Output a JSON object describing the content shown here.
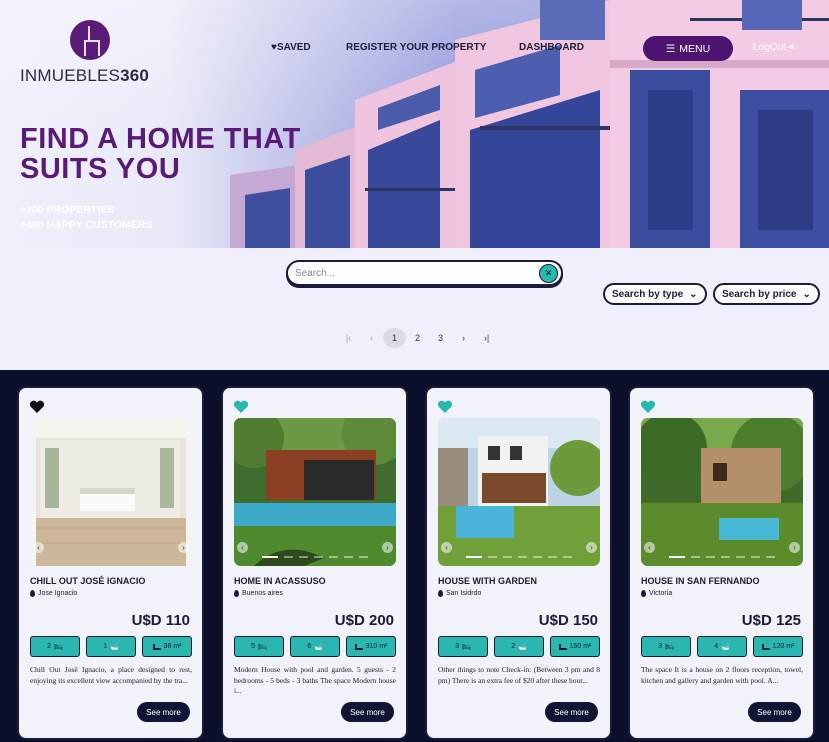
{
  "brand": {
    "name_light": "INMUEBLES",
    "name_bold": "360"
  },
  "nav": {
    "saved": "♥SAVED",
    "register": "REGISTER YOUR PROPERTY",
    "dashboard": "DASHBOARD",
    "menu": "MENU",
    "logout": "LogOut"
  },
  "hero": {
    "headline_line1": "FIND A HOME THAT",
    "headline_line2": "SUITS YOU",
    "stat1": "+200 PROPERTIES",
    "stat2": "+400 HAPPY CUSTOMERS"
  },
  "search": {
    "placeholder": "Search..."
  },
  "filters": {
    "type": "Search by type",
    "price": "Search by price"
  },
  "pagination": {
    "pages": [
      "1",
      "2",
      "3"
    ],
    "current": "1"
  },
  "colors": {
    "brand_purple": "#5a1a78",
    "accent_teal": "#2ab7b0",
    "dark_navy": "#0b0f2a"
  },
  "listings": [
    {
      "title": "CHILL OUT JOSÉ IGNACIO",
      "location": "Jose Ignacio",
      "price": "U$D 110",
      "bedrooms": "2",
      "bathrooms": "1",
      "area": "38 m²",
      "description": "Chill Out José Ignacio, a place designed to rest, enjoying its excellent view accompanied by the tra...",
      "button": "See more",
      "saved": true
    },
    {
      "title": "HOME IN ACASSUSO",
      "location": "Buenos aires",
      "price": "U$D 200",
      "bedrooms": "5",
      "bathrooms": "6",
      "area": "310 m²",
      "description": "Modern House with pool and garden. 5 guests - 2 bedrooms - 5 beds - 3 baths The space Modern house i...",
      "button": "See more",
      "saved": false
    },
    {
      "title": "HOUSE WITH GARDEN",
      "location": "San Isidrdo",
      "price": "U$D 150",
      "bedrooms": "3",
      "bathrooms": "2",
      "area": "160 m²",
      "description": "Other things to note Check-in: (Between 3 pm and 8 pm) There is an extra fee of $20 after these hour...",
      "button": "See more",
      "saved": false
    },
    {
      "title": "HOUSE IN SAN FERNANDO",
      "location": "Victoria",
      "price": "U$D 125",
      "bedrooms": "3",
      "bathrooms": "4",
      "area": "120 m²",
      "description": "The space It is a house on 2 floors reception, towel, kitchen and gallery and garden with pool. A...",
      "button": "See more",
      "saved": false
    }
  ]
}
